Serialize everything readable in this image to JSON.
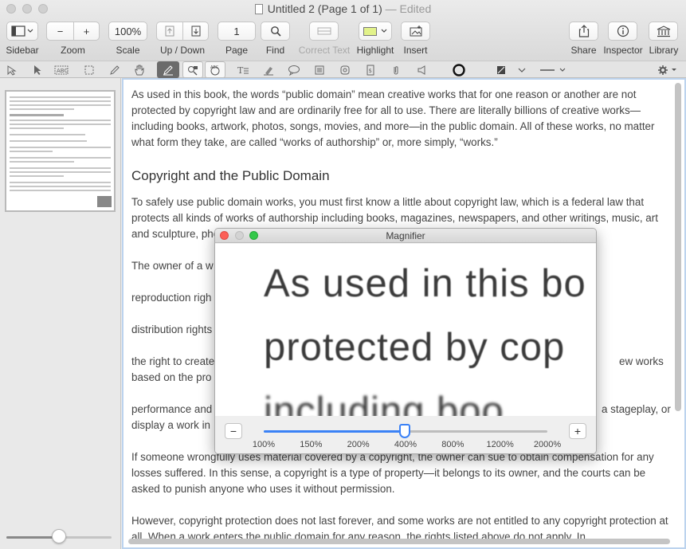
{
  "window": {
    "title": "Untitled 2 (Page 1 of 1)",
    "title_status": "— Edited"
  },
  "toolbar": {
    "sidebar_label": "Sidebar",
    "zoom_label": "Zoom",
    "zoom_out": "−",
    "zoom_in": "+",
    "scale_value": "100%",
    "scale_label": "Scale",
    "updown_label": "Up / Down",
    "page_value": "1",
    "page_label": "Page",
    "find_label": "Find",
    "correct_text_label": "Correct Text",
    "highlight_label": "Highlight",
    "highlight_color": "#e2f28a",
    "insert_label": "Insert",
    "share_label": "Share",
    "inspector_label": "Inspector",
    "library_label": "Library"
  },
  "markup_tools": [
    "select-pointer-icon",
    "arrow-icon",
    "text-select-icon",
    "rect-select-icon",
    "pen-icon",
    "hand-icon",
    "draw-pen-icon",
    "shape-search-icon",
    "ocr-icon",
    "text-box-icon",
    "highlighter-icon",
    "speech-bubble-icon",
    "note-icon",
    "shapes-icon",
    "stamp-icon",
    "attachment-icon",
    "sound-icon",
    "stroke-color-icon",
    "fill-color-icon",
    "line-style-icon",
    "gear-icon"
  ],
  "document": {
    "p1": "As used in this book, the words “public domain” mean creative works that for one reason or another are not protected by copyright law and are ordinarily free for all to use. There are literally billions of creative works—including books, artwork, photos, songs, movies, and more—in the public domain. All of these works, no matter what form they take, are called “works of authorship” or, more simply, “works.”",
    "heading": "Copyright and the Public Domain",
    "p2": "To safely use public domain works, you must first know a little about copyright law, which is a federal law that protects all kinds of works of authorship including books, magazines, newspapers, and other writings, music, art and sculpture, photos, films and videos, choreography, architecture, computer software, and maps.",
    "p3": "The owner of a w",
    "p4": "reproduction righ",
    "p5": "distribution rights",
    "p6a": "the right to create",
    "p6b": "ew works",
    "p6c": "based on the pro",
    "p7a": "performance and",
    "p7b": "a stageplay, or",
    "p7c": "display a work in",
    "p8a": "If someone wrongfully uses material covered by a copyright, the owner can sue to obtain compensation for any",
    "p8b": "losses suffered. In this sense, a copyright is a type of property—it belongs to its owner, and the courts can be asked to punish anyone who uses it without permission.",
    "p9": "However, copyright protection does not last forever, and some works are not entitled to any copyright protection at all. When a work enters the public domain for any reason, the rights listed above do not apply. In"
  },
  "magnifier": {
    "title": "Magnifier",
    "line1": "As used in this bo",
    "line2": "protected by cop",
    "line3": "including boo",
    "minus": "−",
    "plus": "+",
    "ticks": [
      "100%",
      "150%",
      "200%",
      "400%",
      "800%",
      "1200%",
      "2000%"
    ],
    "level_index": 3,
    "level": "400%"
  },
  "sidebar": {
    "thumb_zoom_fraction": 0.5
  }
}
